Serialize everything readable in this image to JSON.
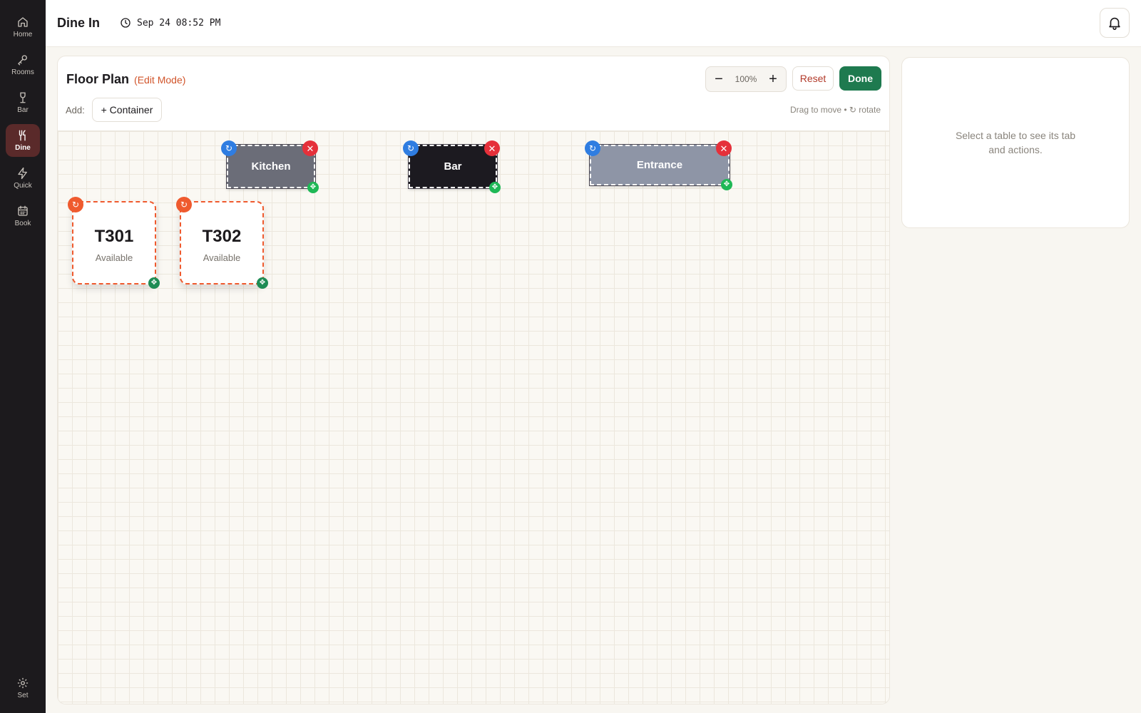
{
  "sidebar": {
    "items": [
      {
        "label": "Home",
        "icon": "home-icon"
      },
      {
        "label": "Rooms",
        "icon": "key-icon"
      },
      {
        "label": "Bar",
        "icon": "wine-glass-icon"
      },
      {
        "label": "Dine",
        "icon": "utensils-icon",
        "active": true
      },
      {
        "label": "Quick",
        "icon": "lightning-icon"
      },
      {
        "label": "Book",
        "icon": "calendar-icon"
      }
    ],
    "settings": {
      "label": "Set",
      "icon": "gear-icon"
    }
  },
  "header": {
    "title": "Dine In",
    "datetime": "Sep 24 08:52 PM"
  },
  "floor_plan": {
    "title": "Floor Plan",
    "mode": "(Edit Mode)",
    "zoom": {
      "minus": "−",
      "value": "100%",
      "plus": "+"
    },
    "reset_label": "Reset",
    "done_label": "Done",
    "add_label": "Add:",
    "add_container_label": "+ Container",
    "hint": "Drag to move • ↻ rotate",
    "zones": [
      {
        "label": "Kitchen",
        "color": "#6b6d78"
      },
      {
        "label": "Bar",
        "color": "#1c1a20"
      },
      {
        "label": "Entrance",
        "color": "#8e95a6"
      }
    ],
    "tables": [
      {
        "name": "T301",
        "status": "Available"
      },
      {
        "name": "T302",
        "status": "Available"
      }
    ]
  },
  "details_panel": {
    "empty_message": "Select a table to see its tab and actions."
  },
  "colors": {
    "accent_green": "#1e7a4f",
    "edit_orange": "#ef5a2e",
    "sidebar_active": "#5a2a2a"
  }
}
